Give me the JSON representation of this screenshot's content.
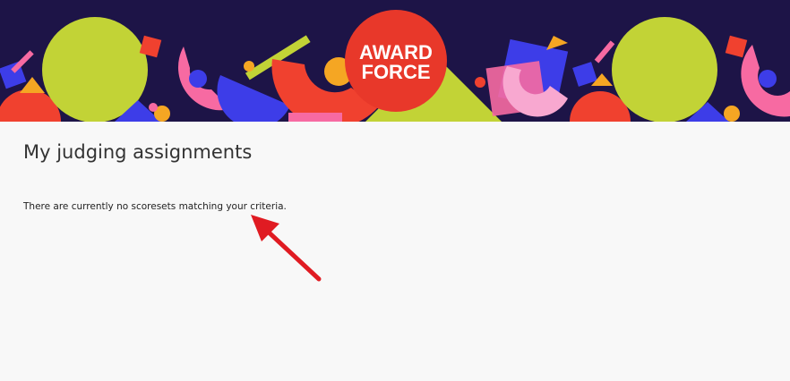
{
  "banner": {
    "logo": {
      "line1": "AWARD",
      "line2": "FORCE"
    },
    "colors": {
      "background": "#1d1447",
      "lime": "#c2d336",
      "red": "#f0412f",
      "pink": "#f76aa2",
      "blue": "#3d3de8",
      "orange": "#f5a623",
      "logo_red": "#e8382a"
    }
  },
  "main": {
    "title": "My judging assignments",
    "empty_message": "There are currently no scoresets matching your criteria."
  },
  "annotation": {
    "arrow_color": "#e01b22"
  }
}
